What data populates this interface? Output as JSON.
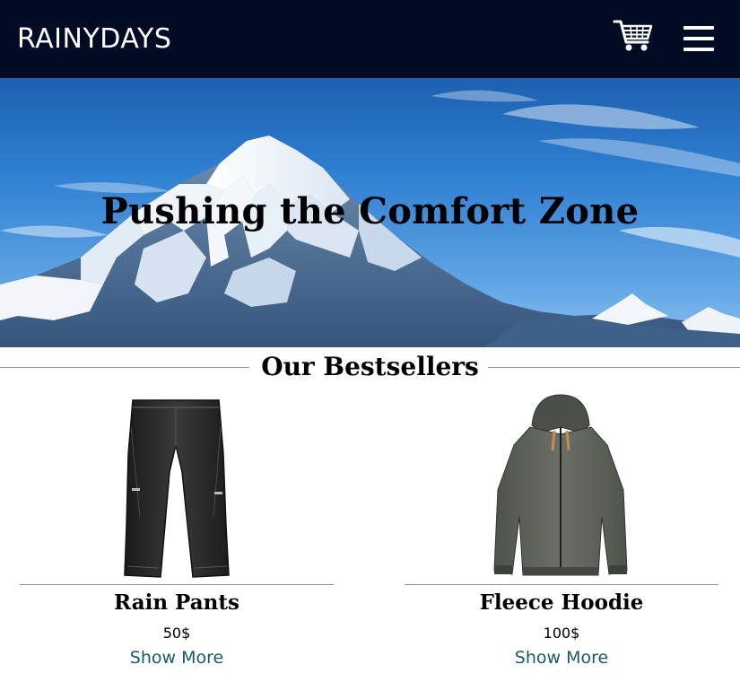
{
  "header": {
    "logo": "RAINYDAYS",
    "cart_icon": "shopping-cart-icon",
    "menu_icon": "hamburger-menu-icon"
  },
  "hero": {
    "title": "Pushing the Comfort Zone",
    "image": "snowy-mountain-peak"
  },
  "bestsellers": {
    "heading": "Our Bestsellers",
    "products": [
      {
        "name": "Rain Pants",
        "price": "50$",
        "link": "Show More",
        "image": "black-rain-pants"
      },
      {
        "name": "Fleece Hoodie",
        "price": "100$",
        "link": "Show More",
        "image": "grey-fleece-hoodie"
      }
    ]
  },
  "colors": {
    "header_bg": "#020b24",
    "link": "#1a5a6b"
  }
}
